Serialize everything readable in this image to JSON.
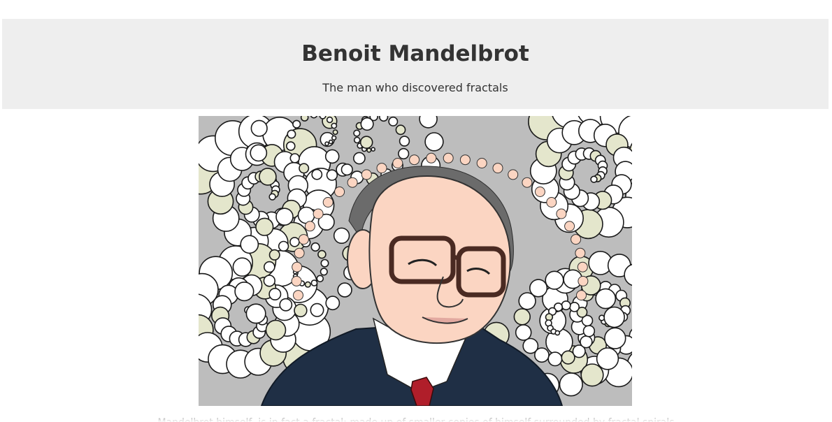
{
  "header": {
    "title": "Benoit Mandelbrot",
    "subtitle": "The man who discovered fractals"
  },
  "portrait": {
    "alt": "Illustration of Benoit Mandelbrot surrounded by fractal spirals",
    "colors": {
      "background": "#bdbdbd",
      "skin": "#fbd5c2",
      "suit": "#1f2f45",
      "shirt": "#ffffff",
      "tie": "#b01e2a",
      "glasses": "#4a2a22",
      "spiral_accent": "#e4e6cc"
    }
  },
  "caption": {
    "text": "Mandelbrot himself, is in fact a fractal: made up of smaller copies of himself surrounded by fractal spirals"
  }
}
